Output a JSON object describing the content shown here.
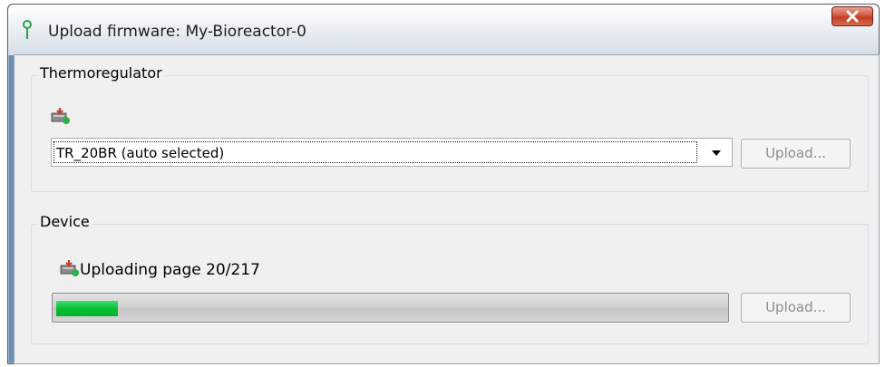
{
  "window": {
    "title": "Upload firmware: My-Bioreactor-0",
    "title_icon": "green-pin-icon",
    "close_icon": "close-icon"
  },
  "thermoregulator": {
    "group_label": "Thermoregulator",
    "icon": "firmware-chip-icon",
    "firmware_select_value": "TR_20BR (auto selected)",
    "upload_label": "Upload..."
  },
  "device": {
    "group_label": "Device",
    "icon": "firmware-chip-icon",
    "status_text": "Uploading page 20/217",
    "progress_fraction": 0.092,
    "upload_label": "Upload..."
  },
  "colors": {
    "progress_green": "#06c034",
    "close_red": "#c33c22"
  }
}
